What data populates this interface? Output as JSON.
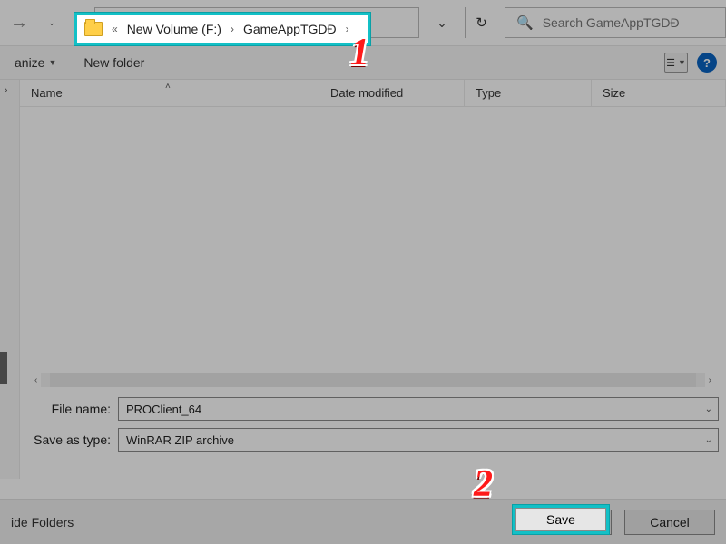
{
  "nav": {
    "back_icon": "→",
    "up_icon": "↑"
  },
  "breadcrumb": {
    "overflow": "«",
    "items": [
      "New Volume (F:)",
      "GameAppTGDĐ"
    ],
    "sep": "›"
  },
  "address": {
    "dropdown_icon": "⌄",
    "refresh_icon": "↻"
  },
  "search": {
    "icon": "🔍",
    "placeholder": "Search GameAppTGDĐ"
  },
  "toolbar": {
    "organize": "anize",
    "organize_caret": "▼",
    "new_folder": "New folder",
    "view_icon": "☰",
    "view_caret": "▼",
    "help_icon": "?"
  },
  "columns": {
    "name": "Name",
    "date": "Date modified",
    "type": "Type",
    "size": "Size",
    "sort_caret": "˄"
  },
  "form": {
    "filename_label": "File name:",
    "filename_value": "PROClient_64",
    "saveastype_label": "Save as type:",
    "saveastype_value": "WinRAR ZIP archive"
  },
  "bottom": {
    "hide_folders": "ide Folders",
    "save": "Save",
    "cancel": "Cancel"
  },
  "annotations": {
    "one": "1",
    "two": "2"
  }
}
